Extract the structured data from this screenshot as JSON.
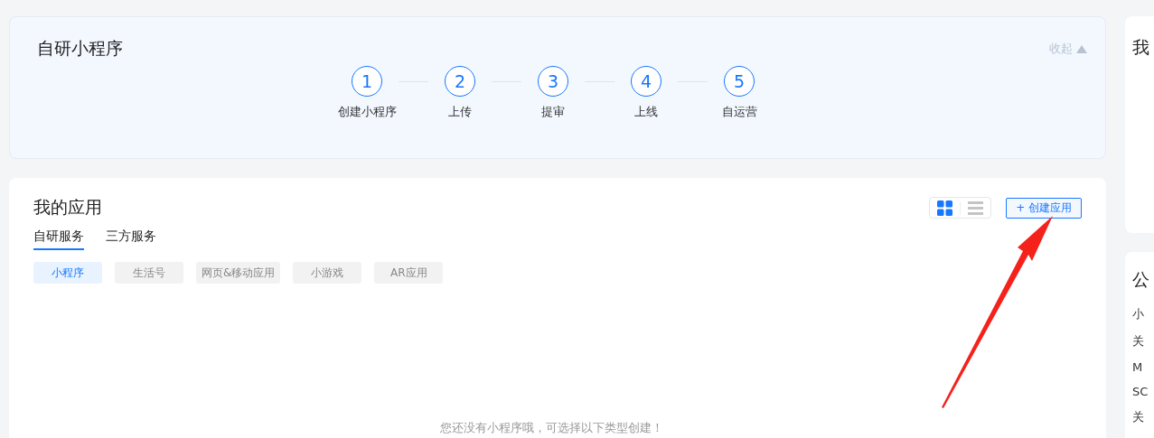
{
  "guide": {
    "title": "自研小程序",
    "collapse_label": "收起",
    "steps": [
      {
        "number": "1",
        "label": "创建小程序"
      },
      {
        "number": "2",
        "label": "上传"
      },
      {
        "number": "3",
        "label": "提审"
      },
      {
        "number": "4",
        "label": "上线"
      },
      {
        "number": "5",
        "label": "自运营"
      }
    ]
  },
  "apps": {
    "title": "我的应用",
    "view_modes": [
      {
        "kind": "grid",
        "selected": true
      },
      {
        "kind": "list",
        "selected": false
      }
    ],
    "create_button": "创建应用",
    "create_icon": "+",
    "tabs": [
      {
        "label": "自研服务",
        "selected": true
      },
      {
        "label": "三方服务",
        "selected": false
      }
    ],
    "filters": [
      {
        "label": "小程序",
        "selected": true
      },
      {
        "label": "生活号",
        "selected": false
      },
      {
        "label": "网页&移动应用",
        "selected": false
      },
      {
        "label": "小游戏",
        "selected": false
      },
      {
        "label": "AR应用",
        "selected": false
      }
    ],
    "empty_message": "您还没有小程序哦，可选择以下类型创建！"
  },
  "side": {
    "top_title": "我",
    "notice_title": "公",
    "notice_items": [
      "小",
      "关",
      "M",
      "SC",
      "关"
    ]
  }
}
